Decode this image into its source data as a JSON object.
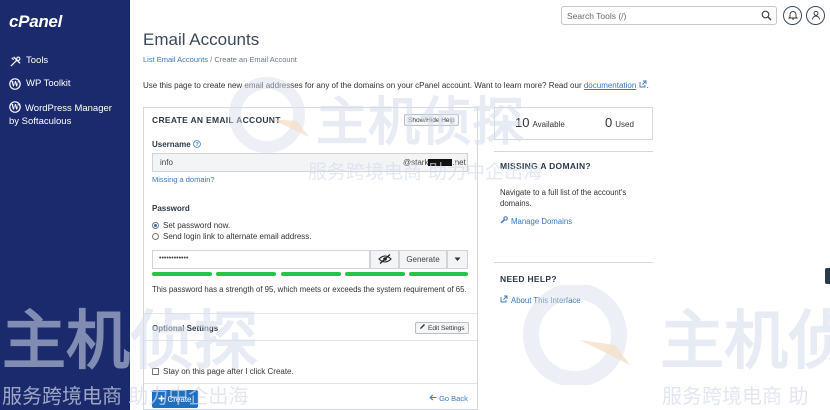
{
  "sidebar": {
    "logo": "cPanel",
    "items": [
      {
        "label": "Tools",
        "icon": "tools-icon"
      },
      {
        "label": "WP Toolkit",
        "icon": "wordpress-icon"
      },
      {
        "label": "WordPress Manager by Softaculous",
        "icon": "wordpress-icon"
      }
    ]
  },
  "header": {
    "search_placeholder": "Search Tools (/)"
  },
  "page": {
    "title": "Email Accounts",
    "breadcrumb_link": "List Email Accounts",
    "breadcrumb_sep": "/",
    "breadcrumb_current": "Create an Email Account",
    "intro": "Use this page to create new email addresses for any of the domains on your cPanel account. Want to learn more? Read our ",
    "intro_link": "documentation",
    "intro_end": "."
  },
  "form": {
    "title": "CREATE AN EMAIL ACCOUNT",
    "show_hide_help": "Show/Hide Help",
    "username_label": "Username",
    "username_value": "info",
    "domain_prefix": "@stark",
    "domain_suffix": ".net",
    "missing_domain_link": "Missing a domain?",
    "password_label": "Password",
    "radio_set_password": "Set password now.",
    "radio_send_link": "Send login link to alternate email address.",
    "password_value": "••••••••••••",
    "generate_label": "Generate",
    "strength_text": "This password has a strength of 95, which meets or exceeds the system requirement of 65.",
    "optional_settings": "Optional Settings",
    "edit_settings": "Edit Settings",
    "stay_on_page": "Stay on this page after I click Create.",
    "create_label": "Create",
    "go_back": "Go Back"
  },
  "stats": {
    "available_num": "10",
    "available_label": "Available",
    "used_num": "0",
    "used_label": "Used"
  },
  "missing_domain": {
    "title": "MISSING A DOMAIN?",
    "text": "Navigate to a full list of the account's domains.",
    "link": "Manage Domains"
  },
  "help": {
    "title": "NEED HELP?",
    "link": "About This Interface"
  },
  "watermark": {
    "text_top": "主机侦探",
    "sub_top": "服务跨境电商 助力中企出海",
    "text_bottom_left": "主机侦探",
    "sub_bottom_left": "服务跨境电商 助力中企出海",
    "text_bottom_right": "主机侦",
    "sub_bottom_right": "服务跨境电商 助"
  },
  "colors": {
    "sidebar_bg": "#1a2a6c",
    "link": "#3a78bb",
    "primary_button": "#1e6fc0",
    "strength_bar": "#23c447"
  }
}
